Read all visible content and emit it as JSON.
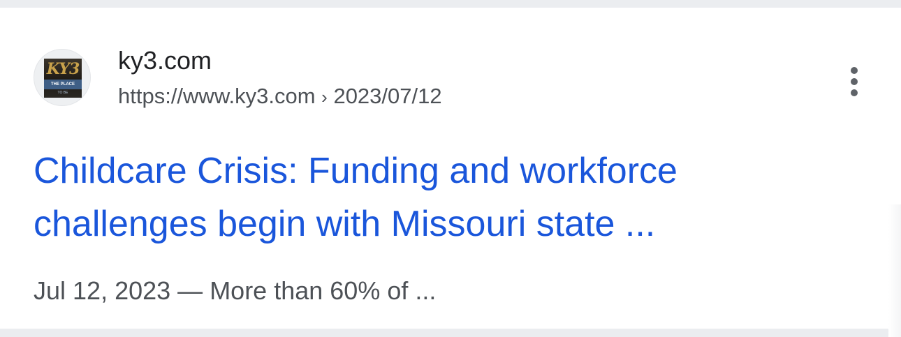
{
  "result": {
    "site_name": "ky3.com",
    "url": "https://www.ky3.com",
    "url_separator": "›",
    "url_path": "2023/07/12",
    "title_line1": "Childcare Crisis: Funding and workforce",
    "title_line2": "challenges begin with Missouri state ...",
    "snippet_date": "Jul 12, 2023",
    "snippet_dash": "—",
    "snippet_text": "More than 60% of ..."
  },
  "favicon": {
    "logo_text": "KY3",
    "band_text": "THE PLACE",
    "sub_text": "TO BE",
    "icon": "ky3-logo-icon"
  },
  "menu": {
    "icon": "more-vert-icon"
  },
  "colors": {
    "title_link": "#1a56db",
    "site_name": "#202124",
    "secondary_text": "#4d5156",
    "background": "#ebedf0",
    "card": "#ffffff"
  }
}
